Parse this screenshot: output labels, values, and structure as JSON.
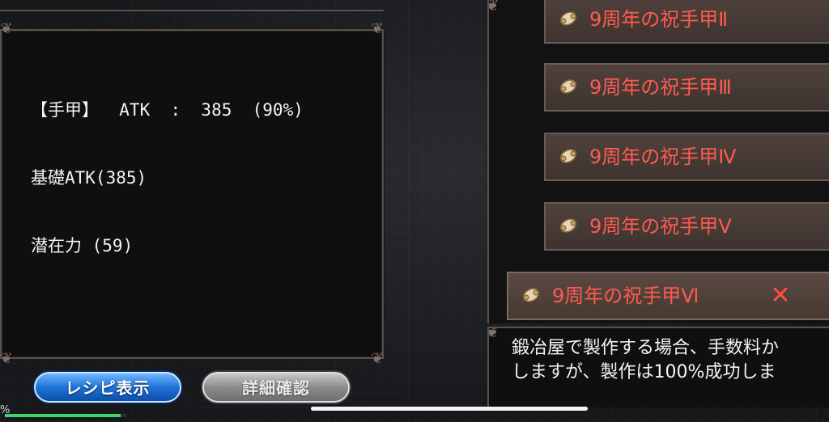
{
  "info": {
    "line1": "【手甲】  ATK  :  385  (90%)",
    "line2": "基礎ATK(385)",
    "line3": "潜在力 (59)"
  },
  "buttons": {
    "recipe_label": "レシピ表示",
    "detail_label": "詳細確認"
  },
  "list": {
    "items": [
      {
        "label": "9周年の祝手甲Ⅱ",
        "icon": "scroll-icon"
      },
      {
        "label": "9周年の祝手甲Ⅲ",
        "icon": "scroll-icon"
      },
      {
        "label": "9周年の祝手甲Ⅳ",
        "icon": "scroll-icon"
      },
      {
        "label": "9周年の祝手甲Ⅴ",
        "icon": "scroll-icon"
      },
      {
        "label": "9周年の祝手甲Ⅵ",
        "icon": "scroll-icon",
        "selected": true
      }
    ],
    "close_glyph": "✕"
  },
  "description": {
    "line1": "鍛冶屋で製作する場合、手数料か",
    "line2": "しますが、製作は100%成功しま"
  },
  "status": {
    "pct_glyph": "%",
    "progress_fraction": 0.95
  },
  "colors": {
    "item_text": "#ff5a50",
    "recipe_button": "#1f73d8",
    "detail_button": "#8c8c8c",
    "progress": "#3fd46b"
  }
}
